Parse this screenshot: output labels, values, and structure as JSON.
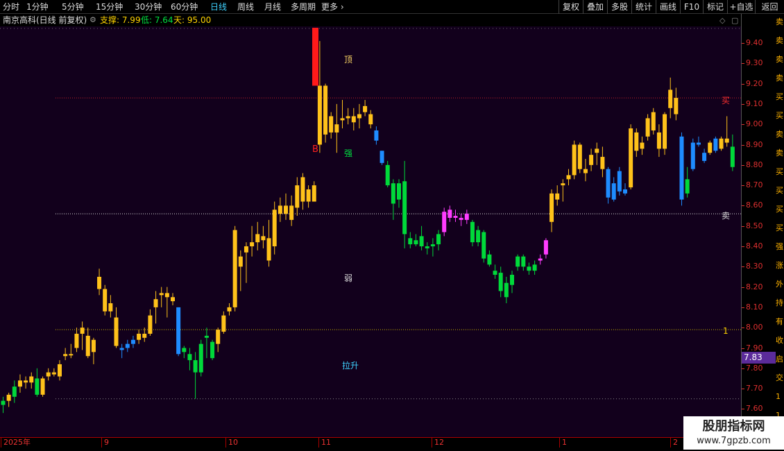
{
  "toolbar": {
    "periods": [
      "分时",
      "1分钟",
      "5分钟",
      "15分钟",
      "30分钟",
      "60分钟",
      "日线",
      "周线",
      "月线",
      "多周期",
      "更多"
    ],
    "active_period": "日线",
    "right_buttons": [
      "复权",
      "叠加",
      "多股",
      "统计",
      "画线",
      "F10",
      "标记",
      "+自选",
      "返回"
    ]
  },
  "info_bar": {
    "title": "南京高科(日线 前复权)",
    "support_label": "支撑: 7.99",
    "low_label": "低: 7.64",
    "days_label": "天: 95.00"
  },
  "annotations": {
    "top": "顶",
    "strong": "强",
    "weak": "弱",
    "lift": "拉升",
    "b_signal": "B",
    "buy": "买",
    "sell": "卖",
    "one": "1"
  },
  "price_axis": {
    "labels": [
      "9.40",
      "9.30",
      "9.20",
      "9.10",
      "9.00",
      "8.90",
      "8.80",
      "8.70",
      "8.60",
      "8.50",
      "8.40",
      "8.30",
      "8.20",
      "8.10",
      "8.00",
      "7.90",
      "7.80",
      "7.70",
      "7.60"
    ],
    "current_price": "7.83"
  },
  "date_axis": [
    "2025年",
    "9",
    "10",
    "11",
    "12",
    "1",
    "2"
  ],
  "right_strip": [
    "卖",
    "卖",
    "卖",
    "卖",
    "买",
    "买",
    "卖",
    "卖",
    "买",
    "买",
    "买",
    "买",
    "强",
    "涨",
    "外",
    "持",
    "有",
    "收",
    "启",
    "交",
    "1",
    "1"
  ],
  "watermark": {
    "title": "股朋指标网",
    "url": "www.7gpzb.com"
  },
  "levels": {
    "buy_line": 9.13,
    "sell_line": 8.56,
    "support_line": 7.99,
    "low_line": 7.65
  },
  "colors": {
    "yellow": "#ffc21a",
    "green": "#00d93a",
    "blue": "#1e8cff",
    "magenta": "#ff3cff",
    "red": "#ff1a1a",
    "background": "#12001c"
  },
  "candles": [
    {
      "o": 7.62,
      "h": 7.66,
      "l": 7.58,
      "c": 7.64,
      "color": "green"
    },
    {
      "o": 7.64,
      "h": 7.68,
      "l": 7.61,
      "c": 7.67,
      "color": "yellow"
    },
    {
      "o": 7.66,
      "h": 7.74,
      "l": 7.63,
      "c": 7.71,
      "color": "green"
    },
    {
      "o": 7.71,
      "h": 7.77,
      "l": 7.68,
      "c": 7.74,
      "color": "yellow"
    },
    {
      "o": 7.74,
      "h": 7.76,
      "l": 7.7,
      "c": 7.73,
      "color": "yellow"
    },
    {
      "o": 7.73,
      "h": 7.78,
      "l": 7.7,
      "c": 7.76,
      "color": "yellow"
    },
    {
      "o": 7.75,
      "h": 7.8,
      "l": 7.66,
      "c": 7.67,
      "color": "green"
    },
    {
      "o": 7.67,
      "h": 7.76,
      "l": 7.66,
      "c": 7.75,
      "color": "yellow"
    },
    {
      "o": 7.76,
      "h": 7.8,
      "l": 7.74,
      "c": 7.78,
      "color": "yellow"
    },
    {
      "o": 7.78,
      "h": 7.8,
      "l": 7.76,
      "c": 7.77,
      "color": "yellow"
    },
    {
      "o": 7.76,
      "h": 7.84,
      "l": 7.74,
      "c": 7.82,
      "color": "yellow"
    },
    {
      "o": 7.86,
      "h": 7.9,
      "l": 7.84,
      "c": 7.87,
      "color": "yellow"
    },
    {
      "o": 7.87,
      "h": 7.92,
      "l": 7.85,
      "c": 7.87,
      "color": "yellow"
    },
    {
      "o": 7.9,
      "h": 8.0,
      "l": 7.88,
      "c": 7.97,
      "color": "yellow"
    },
    {
      "o": 7.97,
      "h": 8.03,
      "l": 7.89,
      "c": 8.0,
      "color": "yellow"
    },
    {
      "o": 7.86,
      "h": 8.0,
      "l": 7.85,
      "c": 7.96,
      "color": "yellow"
    },
    {
      "o": 7.88,
      "h": 7.95,
      "l": 7.82,
      "c": 7.94,
      "color": "yellow"
    },
    {
      "o": 8.19,
      "h": 8.29,
      "l": 8.16,
      "c": 8.25,
      "color": "yellow"
    },
    {
      "o": 8.19,
      "h": 8.21,
      "l": 8.06,
      "c": 8.08,
      "color": "yellow"
    },
    {
      "o": 8.08,
      "h": 8.16,
      "l": 8.05,
      "c": 8.12,
      "color": "yellow"
    },
    {
      "o": 8.05,
      "h": 8.1,
      "l": 7.9,
      "c": 7.91,
      "color": "yellow"
    },
    {
      "o": 7.9,
      "h": 7.92,
      "l": 7.85,
      "c": 7.89,
      "color": "blue"
    },
    {
      "o": 7.9,
      "h": 7.94,
      "l": 7.88,
      "c": 7.92,
      "color": "blue"
    },
    {
      "o": 7.92,
      "h": 7.96,
      "l": 7.9,
      "c": 7.94,
      "color": "blue"
    },
    {
      "o": 7.94,
      "h": 7.99,
      "l": 7.92,
      "c": 7.97,
      "color": "yellow"
    },
    {
      "o": 7.97,
      "h": 8.0,
      "l": 7.93,
      "c": 7.95,
      "color": "yellow"
    },
    {
      "o": 7.97,
      "h": 8.09,
      "l": 7.96,
      "c": 8.06,
      "color": "yellow"
    },
    {
      "o": 8.1,
      "h": 8.18,
      "l": 8.02,
      "c": 8.14,
      "color": "yellow"
    },
    {
      "o": 8.16,
      "h": 8.2,
      "l": 8.1,
      "c": 8.17,
      "color": "yellow"
    },
    {
      "o": 8.17,
      "h": 8.2,
      "l": 8.05,
      "c": 8.15,
      "color": "yellow"
    },
    {
      "o": 8.15,
      "h": 8.17,
      "l": 8.11,
      "c": 8.13,
      "color": "yellow"
    },
    {
      "o": 8.1,
      "h": 8.1,
      "l": 7.86,
      "c": 7.87,
      "color": "blue"
    },
    {
      "o": 7.88,
      "h": 7.91,
      "l": 7.85,
      "c": 7.9,
      "color": "green"
    },
    {
      "o": 7.87,
      "h": 7.9,
      "l": 7.79,
      "c": 7.84,
      "color": "green"
    },
    {
      "o": 7.84,
      "h": 7.88,
      "l": 7.65,
      "c": 7.78,
      "color": "green"
    },
    {
      "o": 7.78,
      "h": 7.94,
      "l": 7.76,
      "c": 7.92,
      "color": "green"
    },
    {
      "o": 7.95,
      "h": 8.0,
      "l": 7.85,
      "c": 7.96,
      "color": "green"
    },
    {
      "o": 7.85,
      "h": 7.94,
      "l": 7.84,
      "c": 7.93,
      "color": "green"
    },
    {
      "o": 7.92,
      "h": 8.0,
      "l": 7.88,
      "c": 7.99,
      "color": "yellow"
    },
    {
      "o": 7.98,
      "h": 8.08,
      "l": 7.97,
      "c": 8.06,
      "color": "yellow"
    },
    {
      "o": 8.08,
      "h": 8.12,
      "l": 8.06,
      "c": 8.1,
      "color": "yellow"
    },
    {
      "o": 8.1,
      "h": 8.5,
      "l": 8.08,
      "c": 8.48,
      "color": "yellow"
    },
    {
      "o": 8.3,
      "h": 8.38,
      "l": 8.18,
      "c": 8.35,
      "color": "yellow"
    },
    {
      "o": 8.37,
      "h": 8.42,
      "l": 8.22,
      "c": 8.4,
      "color": "yellow"
    },
    {
      "o": 8.4,
      "h": 8.5,
      "l": 8.35,
      "c": 8.42,
      "color": "yellow"
    },
    {
      "o": 8.42,
      "h": 8.52,
      "l": 8.38,
      "c": 8.46,
      "color": "yellow"
    },
    {
      "o": 8.45,
      "h": 8.5,
      "l": 8.39,
      "c": 8.43,
      "color": "yellow"
    },
    {
      "o": 8.44,
      "h": 8.53,
      "l": 8.3,
      "c": 8.33,
      "color": "yellow"
    },
    {
      "o": 8.4,
      "h": 8.62,
      "l": 8.36,
      "c": 8.58,
      "color": "yellow"
    },
    {
      "o": 8.6,
      "h": 8.64,
      "l": 8.52,
      "c": 8.56,
      "color": "yellow"
    },
    {
      "o": 8.56,
      "h": 8.66,
      "l": 8.53,
      "c": 8.6,
      "color": "yellow"
    },
    {
      "o": 8.6,
      "h": 8.65,
      "l": 8.5,
      "c": 8.53,
      "color": "yellow"
    },
    {
      "o": 8.59,
      "h": 8.74,
      "l": 8.55,
      "c": 8.7,
      "color": "yellow"
    },
    {
      "o": 8.74,
      "h": 8.76,
      "l": 8.58,
      "c": 8.62,
      "color": "yellow"
    },
    {
      "o": 8.62,
      "h": 8.7,
      "l": 8.59,
      "c": 8.68,
      "color": "yellow"
    },
    {
      "o": 8.7,
      "h": 8.72,
      "l": 8.62,
      "c": 8.62,
      "color": "yellow"
    },
    {
      "o": 8.9,
      "h": 9.41,
      "l": 8.86,
      "c": 9.19,
      "color": "yellow"
    },
    {
      "o": 9.19,
      "h": 9.2,
      "l": 8.91,
      "c": 8.95,
      "color": "yellow"
    },
    {
      "o": 8.96,
      "h": 9.06,
      "l": 8.93,
      "c": 9.04,
      "color": "yellow"
    },
    {
      "o": 9.0,
      "h": 9.1,
      "l": 8.86,
      "c": 8.96,
      "color": "yellow"
    },
    {
      "o": 9.02,
      "h": 9.12,
      "l": 8.98,
      "c": 9.03,
      "color": "yellow"
    },
    {
      "o": 9.03,
      "h": 9.08,
      "l": 9.0,
      "c": 9.04,
      "color": "yellow"
    },
    {
      "o": 9.04,
      "h": 9.08,
      "l": 8.97,
      "c": 9.01,
      "color": "yellow"
    },
    {
      "o": 9.03,
      "h": 9.1,
      "l": 8.98,
      "c": 9.05,
      "color": "yellow"
    },
    {
      "o": 9.06,
      "h": 9.12,
      "l": 9.04,
      "c": 9.09,
      "color": "yellow"
    },
    {
      "o": 9.05,
      "h": 9.07,
      "l": 8.98,
      "c": 9.0,
      "color": "yellow"
    },
    {
      "o": 8.97,
      "h": 8.99,
      "l": 8.9,
      "c": 8.92,
      "color": "blue"
    },
    {
      "o": 8.87,
      "h": 8.87,
      "l": 8.8,
      "c": 8.81,
      "color": "blue"
    },
    {
      "o": 8.8,
      "h": 8.82,
      "l": 8.69,
      "c": 8.7,
      "color": "green"
    },
    {
      "o": 8.71,
      "h": 8.73,
      "l": 8.53,
      "c": 8.61,
      "color": "green"
    },
    {
      "o": 8.63,
      "h": 8.73,
      "l": 8.59,
      "c": 8.71,
      "color": "green"
    },
    {
      "o": 8.72,
      "h": 8.82,
      "l": 8.39,
      "c": 8.46,
      "color": "green"
    },
    {
      "o": 8.44,
      "h": 8.47,
      "l": 8.39,
      "c": 8.41,
      "color": "green"
    },
    {
      "o": 8.41,
      "h": 8.46,
      "l": 8.4,
      "c": 8.43,
      "color": "green"
    },
    {
      "o": 8.45,
      "h": 8.5,
      "l": 8.38,
      "c": 8.4,
      "color": "green"
    },
    {
      "o": 8.4,
      "h": 8.42,
      "l": 8.36,
      "c": 8.39,
      "color": "green"
    },
    {
      "o": 8.4,
      "h": 8.44,
      "l": 8.35,
      "c": 8.41,
      "color": "green"
    },
    {
      "o": 8.41,
      "h": 8.48,
      "l": 8.38,
      "c": 8.46,
      "color": "green"
    },
    {
      "o": 8.47,
      "h": 8.59,
      "l": 8.45,
      "c": 8.57,
      "color": "magenta"
    },
    {
      "o": 8.54,
      "h": 8.6,
      "l": 8.52,
      "c": 8.58,
      "color": "magenta"
    },
    {
      "o": 8.55,
      "h": 8.58,
      "l": 8.52,
      "c": 8.54,
      "color": "magenta"
    },
    {
      "o": 8.53,
      "h": 8.56,
      "l": 8.5,
      "c": 8.54,
      "color": "magenta"
    },
    {
      "o": 8.53,
      "h": 8.58,
      "l": 8.51,
      "c": 8.56,
      "color": "magenta"
    },
    {
      "o": 8.52,
      "h": 8.53,
      "l": 8.4,
      "c": 8.42,
      "color": "green"
    },
    {
      "o": 8.48,
      "h": 8.5,
      "l": 8.4,
      "c": 8.42,
      "color": "green"
    },
    {
      "o": 8.47,
      "h": 8.48,
      "l": 8.32,
      "c": 8.34,
      "color": "green"
    },
    {
      "o": 8.36,
      "h": 8.38,
      "l": 8.3,
      "c": 8.31,
      "color": "green"
    },
    {
      "o": 8.28,
      "h": 8.31,
      "l": 8.24,
      "c": 8.26,
      "color": "green"
    },
    {
      "o": 8.27,
      "h": 8.3,
      "l": 8.15,
      "c": 8.18,
      "color": "green"
    },
    {
      "o": 8.22,
      "h": 8.25,
      "l": 8.12,
      "c": 8.15,
      "color": "green"
    },
    {
      "o": 8.21,
      "h": 8.28,
      "l": 8.17,
      "c": 8.26,
      "color": "green"
    },
    {
      "o": 8.3,
      "h": 8.36,
      "l": 8.28,
      "c": 8.35,
      "color": "green"
    },
    {
      "o": 8.3,
      "h": 8.36,
      "l": 8.28,
      "c": 8.35,
      "color": "green"
    },
    {
      "o": 8.28,
      "h": 8.32,
      "l": 8.26,
      "c": 8.3,
      "color": "green"
    },
    {
      "o": 8.31,
      "h": 8.33,
      "l": 8.26,
      "c": 8.28,
      "color": "green"
    },
    {
      "o": 8.33,
      "h": 8.36,
      "l": 8.31,
      "c": 8.34,
      "color": "magenta"
    },
    {
      "o": 8.36,
      "h": 8.44,
      "l": 8.34,
      "c": 8.43,
      "color": "magenta"
    },
    {
      "o": 8.52,
      "h": 8.68,
      "l": 8.47,
      "c": 8.66,
      "color": "yellow"
    },
    {
      "o": 8.63,
      "h": 8.7,
      "l": 8.6,
      "c": 8.66,
      "color": "yellow"
    },
    {
      "o": 8.7,
      "h": 8.73,
      "l": 8.62,
      "c": 8.71,
      "color": "yellow"
    },
    {
      "o": 8.73,
      "h": 8.78,
      "l": 8.7,
      "c": 8.75,
      "color": "yellow"
    },
    {
      "o": 8.75,
      "h": 8.92,
      "l": 8.73,
      "c": 8.9,
      "color": "yellow"
    },
    {
      "o": 8.78,
      "h": 8.91,
      "l": 8.76,
      "c": 8.9,
      "color": "yellow"
    },
    {
      "o": 8.76,
      "h": 8.83,
      "l": 8.72,
      "c": 8.78,
      "color": "yellow"
    },
    {
      "o": 8.8,
      "h": 8.88,
      "l": 8.77,
      "c": 8.85,
      "color": "yellow"
    },
    {
      "o": 8.86,
      "h": 8.91,
      "l": 8.8,
      "c": 8.88,
      "color": "yellow"
    },
    {
      "o": 8.84,
      "h": 8.89,
      "l": 8.74,
      "c": 8.78,
      "color": "yellow"
    },
    {
      "o": 8.78,
      "h": 8.79,
      "l": 8.61,
      "c": 8.64,
      "color": "blue"
    },
    {
      "o": 8.71,
      "h": 8.74,
      "l": 8.62,
      "c": 8.63,
      "color": "blue"
    },
    {
      "o": 8.77,
      "h": 8.79,
      "l": 8.65,
      "c": 8.67,
      "color": "blue"
    },
    {
      "o": 8.68,
      "h": 8.71,
      "l": 8.65,
      "c": 8.66,
      "color": "blue"
    },
    {
      "o": 8.69,
      "h": 9.0,
      "l": 8.68,
      "c": 8.98,
      "color": "yellow"
    },
    {
      "o": 8.96,
      "h": 8.98,
      "l": 8.84,
      "c": 8.87,
      "color": "yellow"
    },
    {
      "o": 8.88,
      "h": 8.94,
      "l": 8.85,
      "c": 8.91,
      "color": "yellow"
    },
    {
      "o": 8.94,
      "h": 9.05,
      "l": 8.92,
      "c": 9.03,
      "color": "yellow"
    },
    {
      "o": 9.06,
      "h": 9.08,
      "l": 8.95,
      "c": 8.97,
      "color": "yellow"
    },
    {
      "o": 8.88,
      "h": 9.0,
      "l": 8.84,
      "c": 8.96,
      "color": "yellow"
    },
    {
      "o": 8.88,
      "h": 9.06,
      "l": 8.85,
      "c": 9.05,
      "color": "yellow"
    },
    {
      "o": 9.17,
      "h": 9.23,
      "l": 9.03,
      "c": 9.08,
      "color": "yellow"
    },
    {
      "o": 9.13,
      "h": 9.18,
      "l": 9.02,
      "c": 9.05,
      "color": "yellow"
    },
    {
      "o": 8.94,
      "h": 8.96,
      "l": 8.6,
      "c": 8.63,
      "color": "blue"
    },
    {
      "o": 8.66,
      "h": 8.79,
      "l": 8.64,
      "c": 8.73,
      "color": "green"
    },
    {
      "o": 8.91,
      "h": 8.93,
      "l": 8.77,
      "c": 8.78,
      "color": "blue"
    },
    {
      "o": 8.9,
      "h": 8.94,
      "l": 8.89,
      "c": 8.91,
      "color": "blue"
    },
    {
      "o": 8.86,
      "h": 8.88,
      "l": 8.81,
      "c": 8.82,
      "color": "blue"
    },
    {
      "o": 8.86,
      "h": 8.92,
      "l": 8.85,
      "c": 8.91,
      "color": "yellow"
    },
    {
      "o": 8.93,
      "h": 8.94,
      "l": 8.86,
      "c": 8.87,
      "color": "blue"
    },
    {
      "o": 8.93,
      "h": 8.94,
      "l": 8.87,
      "c": 8.88,
      "color": "yellow"
    },
    {
      "o": 8.91,
      "h": 9.04,
      "l": 8.89,
      "c": 8.93,
      "color": "yellow"
    },
    {
      "o": 8.89,
      "h": 8.95,
      "l": 8.77,
      "c": 8.79,
      "color": "green"
    }
  ]
}
